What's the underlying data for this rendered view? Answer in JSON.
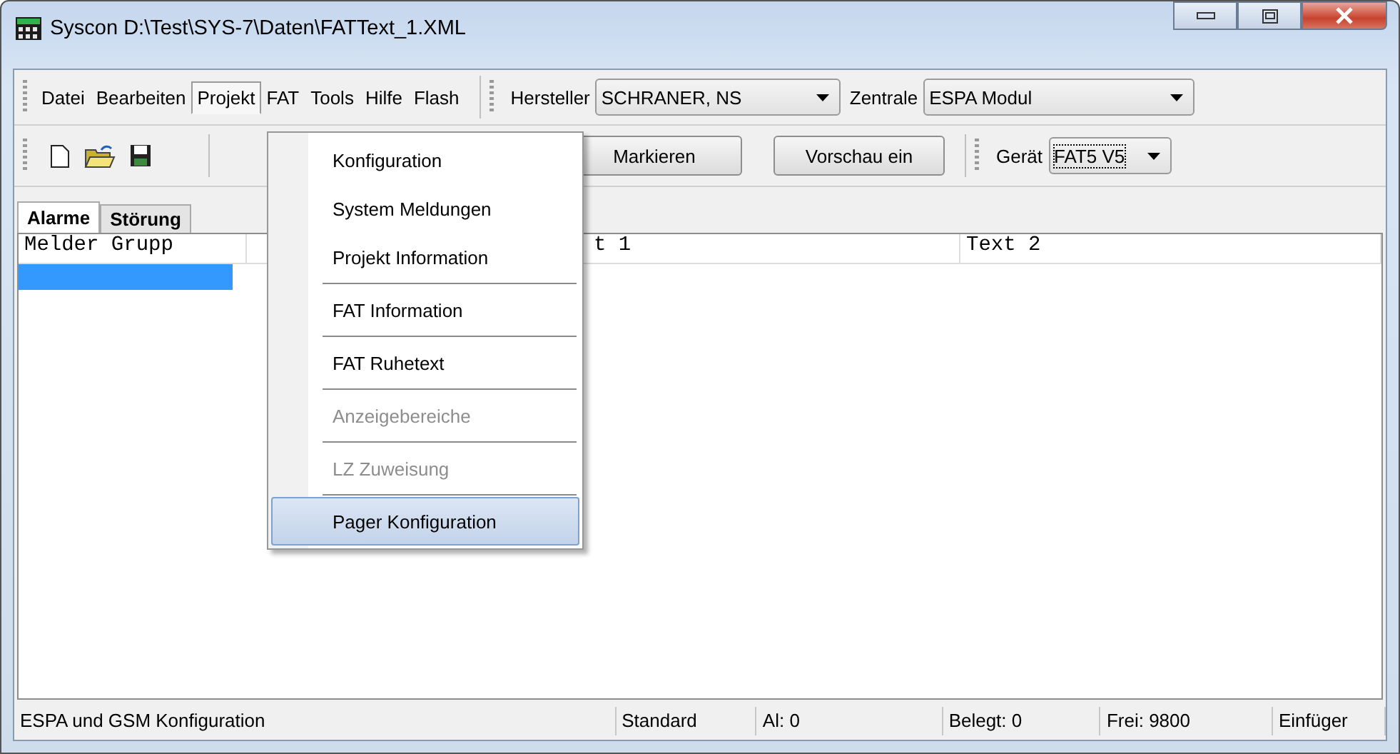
{
  "window": {
    "title": "Syscon  D:\\Test\\SYS-7\\Daten\\FATText_1.XML"
  },
  "menu_bar": [
    {
      "label": "Datei",
      "selected": false
    },
    {
      "label": "Bearbeiten",
      "selected": false
    },
    {
      "label": "Projekt",
      "selected": true
    },
    {
      "label": "FAT",
      "selected": false
    },
    {
      "label": "Tools",
      "selected": false
    },
    {
      "label": "Hilfe",
      "selected": false
    },
    {
      "label": "Flash",
      "selected": false
    }
  ],
  "hersteller": {
    "label": "Hersteller",
    "value": "SCHRANER, NS"
  },
  "zentrale": {
    "label": "Zentrale",
    "value": "ESPA Modul"
  },
  "toolbar_buttons": [
    "Markieren",
    "Vorschau ein"
  ],
  "geraet": {
    "label": "Gerät",
    "value": "FAT5 V5"
  },
  "tabs": [
    {
      "label": "Alarme",
      "selected": true
    },
    {
      "label": "Störung",
      "selected": false
    }
  ],
  "table": {
    "columns": [
      "Melder Grupp",
      "t 1",
      "Text 2"
    ]
  },
  "open_menu": {
    "items": [
      {
        "label": "Konfiguration",
        "disabled": false,
        "selected": false,
        "separator_after": false
      },
      {
        "label": "System Meldungen",
        "disabled": false,
        "selected": false,
        "separator_after": false
      },
      {
        "label": "Projekt Information",
        "disabled": false,
        "selected": false,
        "separator_after": true
      },
      {
        "label": "FAT Information",
        "disabled": false,
        "selected": false,
        "separator_after": true
      },
      {
        "label": "FAT Ruhetext",
        "disabled": false,
        "selected": false,
        "separator_after": true
      },
      {
        "label": "Anzeigebereiche",
        "disabled": true,
        "selected": false,
        "separator_after": true
      },
      {
        "label": "LZ Zuweisung",
        "disabled": true,
        "selected": false,
        "separator_after": true
      },
      {
        "label": "Pager Konfiguration",
        "disabled": false,
        "selected": true,
        "separator_after": false
      }
    ]
  },
  "status_bar": [
    "ESPA und GSM Konfiguration",
    "Standard",
    "Al: 0",
    "Belegt: 0",
    "Frei: 9800",
    "Einfüger"
  ]
}
